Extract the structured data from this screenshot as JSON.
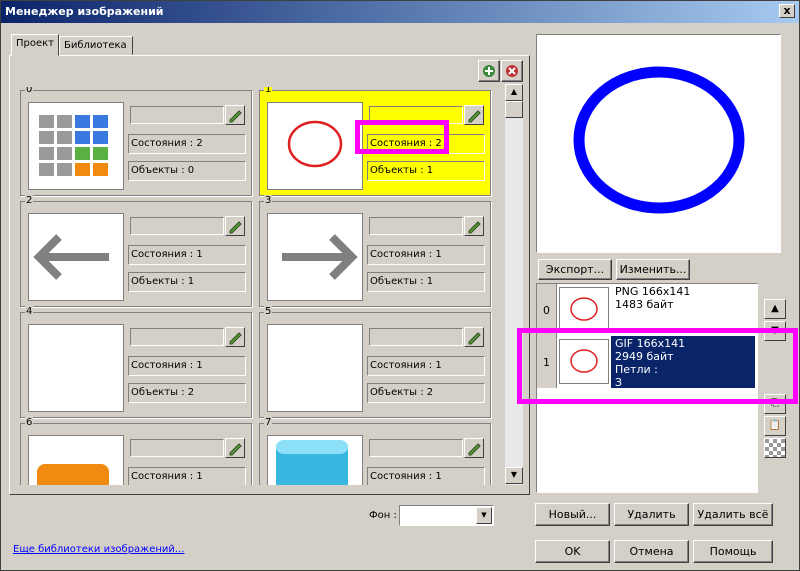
{
  "window": {
    "title": "Менеджер изображений",
    "close_label": "x"
  },
  "tabs": [
    {
      "label": "Проект"
    },
    {
      "label": "Библиотека"
    }
  ],
  "cells": [
    {
      "index": "0",
      "states": "Состояния : 2",
      "objects": "Объекты : 0",
      "thumb": "keypad-image",
      "selected": false
    },
    {
      "index": "1",
      "states": "Состояния : 2",
      "objects": "Объекты : 1",
      "thumb": "red-circle",
      "selected": true
    },
    {
      "index": "2",
      "states": "Состояния : 1",
      "objects": "Объекты : 1",
      "thumb": "arrow-left",
      "selected": false
    },
    {
      "index": "3",
      "states": "Состояния : 1",
      "objects": "Объекты : 1",
      "thumb": "arrow-right",
      "selected": false
    },
    {
      "index": "4",
      "states": "Состояния : 1",
      "objects": "Объекты : 2",
      "thumb": "empty",
      "selected": false
    },
    {
      "index": "5",
      "states": "Состояния : 1",
      "objects": "Объекты : 2",
      "thumb": "empty",
      "selected": false
    },
    {
      "index": "6",
      "states": "Состояния : 1",
      "objects": "",
      "thumb": "orange-button",
      "selected": false
    },
    {
      "index": "7",
      "states": "Состояния : 1",
      "objects": "",
      "thumb": "blue-button",
      "selected": false
    }
  ],
  "buttons": {
    "export": "Экспорт...",
    "edit": "Изменить...",
    "new": "Новый...",
    "delete": "Удалить",
    "delete_all": "Удалить всё",
    "ok": "OK",
    "cancel": "Отмена",
    "help": "Помощь"
  },
  "background": {
    "label": "Фон :",
    "value": ""
  },
  "states_list": [
    {
      "index": "0",
      "text": "PNG 166x141\n1483 байт",
      "selected": false
    },
    {
      "index": "1",
      "text": "GIF 166x141\n2949 байт\nПетли :\nЗ",
      "selected": true
    }
  ],
  "link": "Еще библиотеки изображений...",
  "colors": {
    "selection": "#ffff00",
    "highlight": "#ff00ff",
    "list_selection": "#0a246a",
    "preview_ring": "#0000ff",
    "thumb_ring": "#e02020"
  }
}
